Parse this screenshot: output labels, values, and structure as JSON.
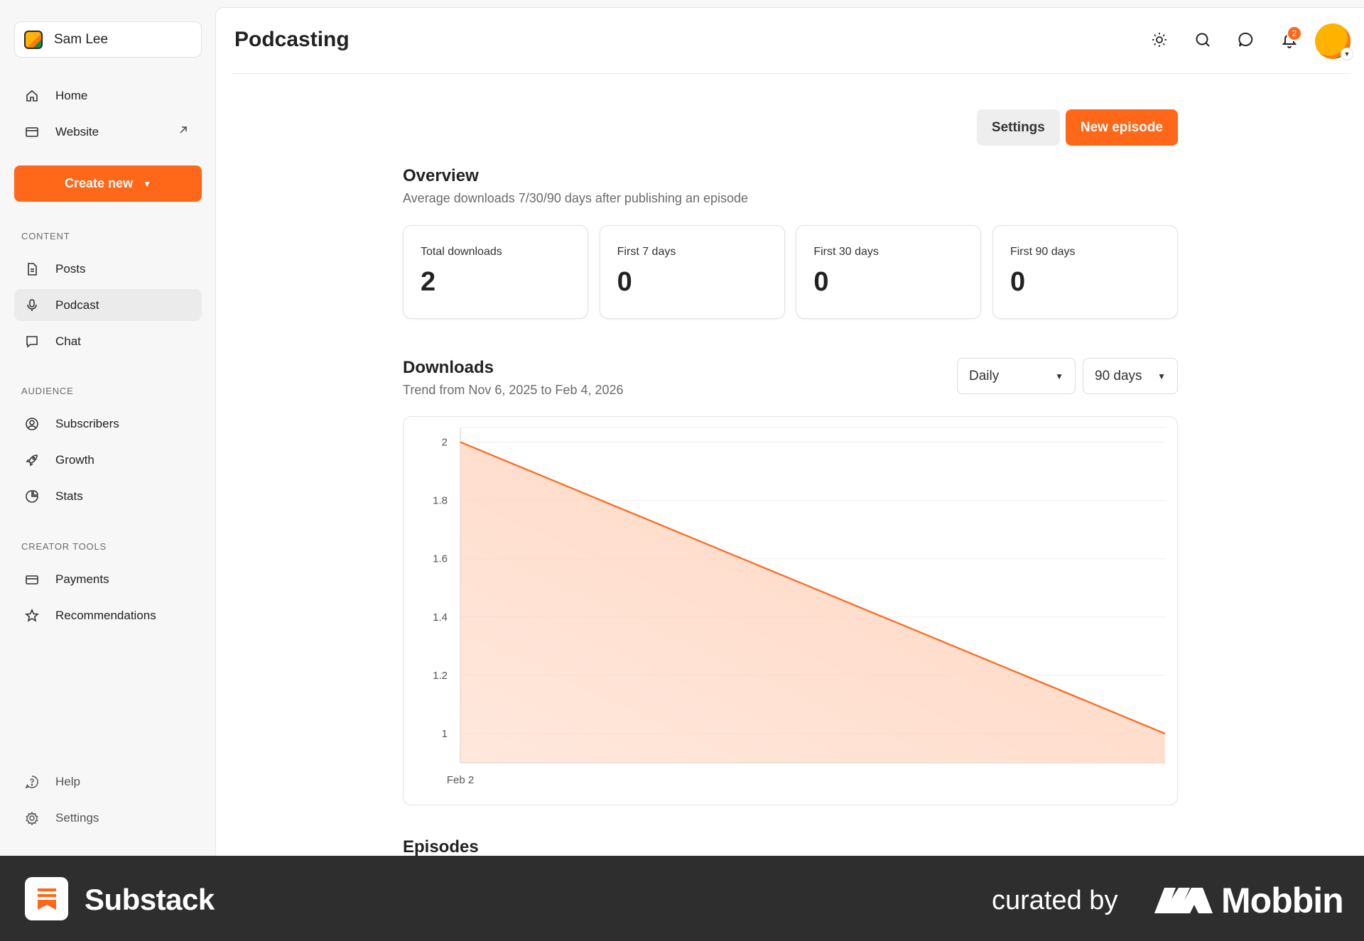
{
  "sidebar": {
    "publication_name": "Sam Lee",
    "nav_top": [
      {
        "label": "Home"
      },
      {
        "label": "Website"
      }
    ],
    "create_new_label": "Create new",
    "sections": [
      {
        "title": "CONTENT",
        "items": [
          {
            "label": "Posts"
          },
          {
            "label": "Podcast"
          },
          {
            "label": "Chat"
          }
        ]
      },
      {
        "title": "AUDIENCE",
        "items": [
          {
            "label": "Subscribers"
          },
          {
            "label": "Growth"
          },
          {
            "label": "Stats"
          }
        ]
      },
      {
        "title": "CREATOR TOOLS",
        "items": [
          {
            "label": "Payments"
          },
          {
            "label": "Recommendations"
          }
        ]
      }
    ],
    "bottom": [
      {
        "label": "Help"
      },
      {
        "label": "Settings"
      }
    ],
    "active_item": "Podcast"
  },
  "header": {
    "title": "Podcasting",
    "notification_count": "2"
  },
  "actions": {
    "settings_label": "Settings",
    "new_episode_label": "New episode"
  },
  "overview": {
    "title": "Overview",
    "subtitle": "Average downloads 7/30/90 days after publishing an episode",
    "stats": [
      {
        "label": "Total downloads",
        "value": "2"
      },
      {
        "label": "First 7 days",
        "value": "0"
      },
      {
        "label": "First 30 days",
        "value": "0"
      },
      {
        "label": "First 90 days",
        "value": "0"
      }
    ]
  },
  "downloads": {
    "title": "Downloads",
    "subtitle": "Trend from Nov 6, 2025 to Feb 4, 2026",
    "interval_select": "Daily",
    "range_select": "90 days"
  },
  "chart_data": {
    "type": "area",
    "x": [
      "Feb 2",
      ""
    ],
    "x_tick_labels": [
      "Feb 2"
    ],
    "values": [
      2,
      1
    ],
    "y_ticks": [
      1,
      1.2,
      1.4,
      1.6,
      1.8,
      2
    ],
    "y_tick_labels": [
      "1",
      "1.2",
      "1.4",
      "1.6",
      "1.8",
      "2"
    ],
    "ylim": [
      0.9,
      2.05
    ],
    "grid": true,
    "color": "#ff6719",
    "fill_color": "#ffd5c0"
  },
  "episodes": {
    "title": "Episodes"
  },
  "footer": {
    "brand": "Substack",
    "curated_by": "curated by",
    "curator": "Mobbin"
  },
  "colors": {
    "accent": "#ff6719",
    "footer_bg": "#2e2e2e"
  }
}
